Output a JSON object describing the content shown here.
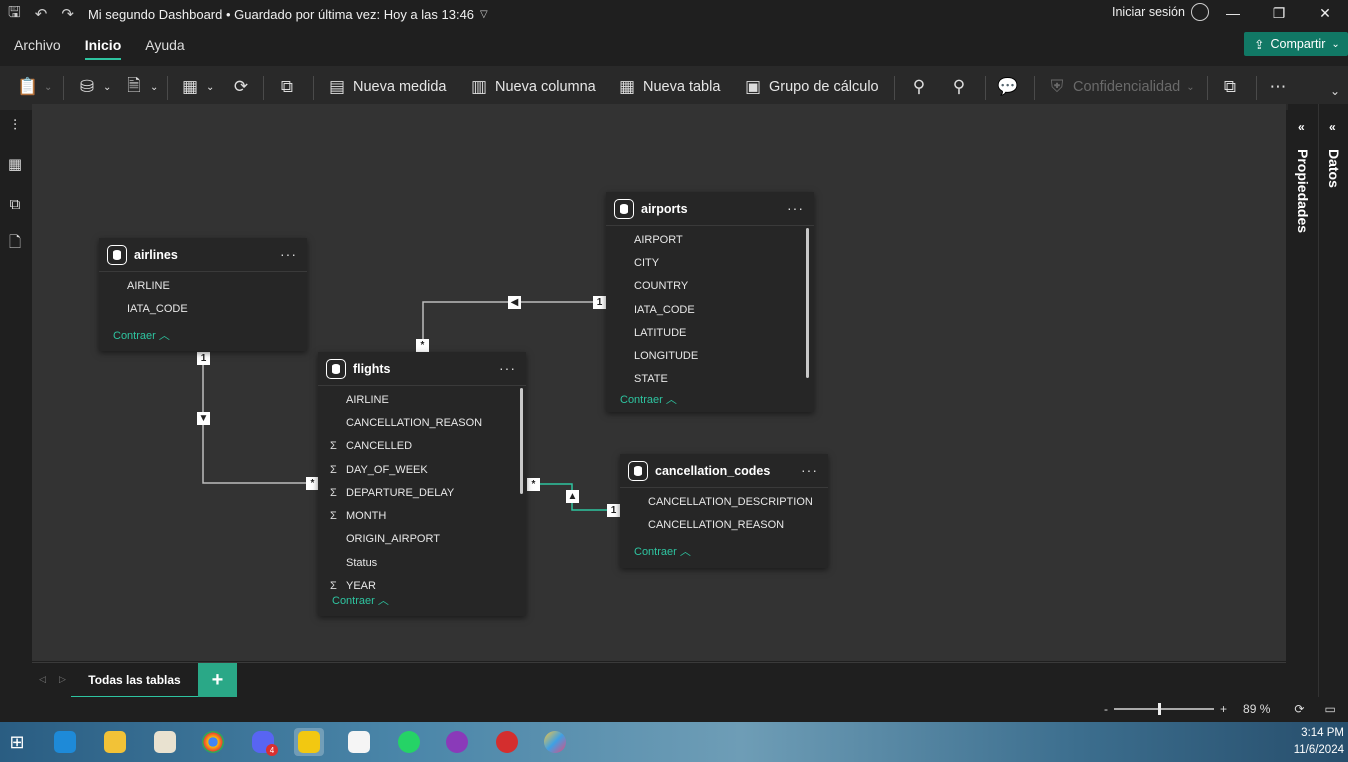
{
  "titlebar": {
    "doc_title": "Mi segundo Dashboard • Guardado por última vez: Hoy a las 13:46",
    "signin": "Iniciar sesión",
    "icons": [
      "save-icon",
      "undo-icon",
      "redo-icon"
    ]
  },
  "menu": {
    "items": [
      "Archivo",
      "Inicio",
      "Ayuda"
    ],
    "active": "Inicio",
    "share_label": "Compartir"
  },
  "ribbon": {
    "new_measure": "Nueva medida",
    "new_column": "Nueva columna",
    "new_table": "Nueva tabla",
    "calc_group": "Grupo de cálculo",
    "sensitivity": "Confidencialidad"
  },
  "panes": {
    "properties": "Propiedades",
    "data": "Datos"
  },
  "tables": {
    "airlines": {
      "name": "airlines",
      "fields": [
        "AIRLINE",
        "IATA_CODE"
      ],
      "collapse": "Contraer"
    },
    "airports": {
      "name": "airports",
      "fields": [
        "AIRPORT",
        "CITY",
        "COUNTRY",
        "IATA_CODE",
        "LATITUDE",
        "LONGITUDE",
        "STATE"
      ],
      "collapse": "Contraer"
    },
    "flights": {
      "name": "flights",
      "fields": [
        "AIRLINE",
        "CANCELLATION_REASON",
        "CANCELLED",
        "DAY_OF_WEEK",
        "DEPARTURE_DELAY",
        "MONTH",
        "ORIGIN_AIRPORT",
        "Status",
        "YEAR"
      ],
      "sigma": [
        false,
        false,
        true,
        true,
        true,
        true,
        false,
        false,
        true
      ],
      "collapse": "Contraer"
    },
    "cancellation_codes": {
      "name": "cancellation_codes",
      "fields": [
        "CANCELLATION_DESCRIPTION",
        "CANCELLATION_REASON"
      ],
      "collapse": "Contraer"
    }
  },
  "relationships": {
    "one_label": "1",
    "many_label": "*"
  },
  "tabs": {
    "active": "Todas las tablas",
    "add": "+"
  },
  "status": {
    "zoom": "89 %",
    "minus": "-",
    "plus": "+"
  },
  "taskbar": {
    "time": "3:14 PM",
    "date": "11/6/2024",
    "badge": "4"
  },
  "colors": {
    "accent": "#2ec4a0",
    "share": "#117865",
    "canvas": "#333333",
    "card": "#262626"
  }
}
